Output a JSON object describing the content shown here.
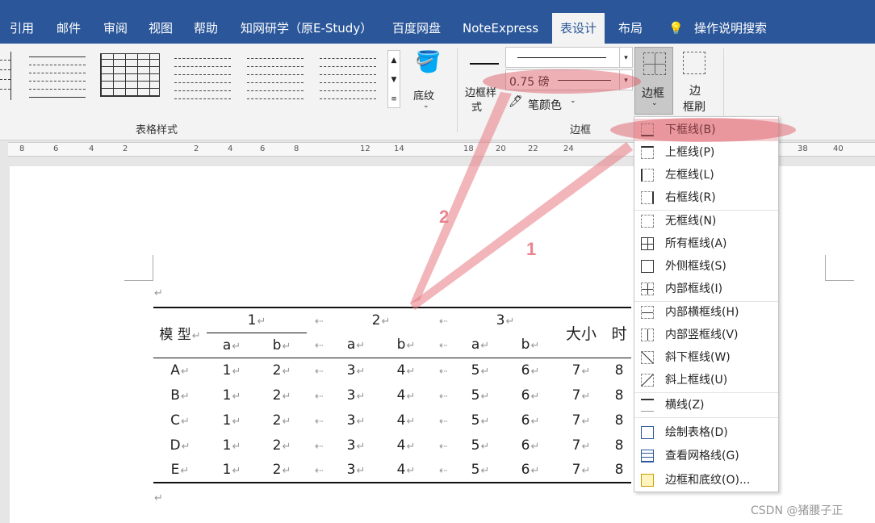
{
  "tabs": [
    "引用",
    "邮件",
    "审阅",
    "视图",
    "帮助",
    "知网研学（原E-Study）",
    "百度网盘",
    "NoteExpress",
    "表设计",
    "布局",
    "操作说明搜索"
  ],
  "active_tab": "表设计",
  "ribbon": {
    "table_styles_label": "表格样式",
    "shading_label": "底纹",
    "border_style_label": "边框样式",
    "border_style_line1": "边框样",
    "border_style_line2": "式",
    "pen_weight": "0.75 磅",
    "pen_color_label": "笔颜色",
    "borders_label": "边框",
    "borders_button": "边框",
    "border_painter_line1": "边",
    "border_painter_line2": "框刷",
    "borders_group_label": "边框"
  },
  "ruler": [
    "8",
    "6",
    "4",
    "2",
    "2",
    "4",
    "6",
    "8",
    "12",
    "14",
    "18",
    "20",
    "22",
    "24",
    "38",
    "40"
  ],
  "table": {
    "header1": [
      "模 型",
      "1",
      "",
      "2",
      "",
      "3",
      "大小",
      "时"
    ],
    "header2": [
      "a",
      "b",
      "",
      "a",
      "b",
      "",
      "a",
      "b"
    ],
    "rows": [
      [
        "A",
        "1",
        "2",
        "",
        "3",
        "4",
        "",
        "5",
        "6",
        "7",
        "8"
      ],
      [
        "B",
        "1",
        "2",
        "",
        "3",
        "4",
        "",
        "5",
        "6",
        "7",
        "8"
      ],
      [
        "C",
        "1",
        "2",
        "",
        "3",
        "4",
        "",
        "5",
        "6",
        "7",
        "8"
      ],
      [
        "D",
        "1",
        "2",
        "",
        "3",
        "4",
        "",
        "5",
        "6",
        "7",
        "8"
      ],
      [
        "E",
        "1",
        "2",
        "",
        "3",
        "4",
        "",
        "5",
        "6",
        "7",
        "8"
      ]
    ]
  },
  "menu": [
    {
      "label": "下框线(B)"
    },
    {
      "label": "上框线(P)"
    },
    {
      "label": "左框线(L)"
    },
    {
      "label": "右框线(R)"
    },
    {
      "label": "无框线(N)"
    },
    {
      "label": "所有框线(A)"
    },
    {
      "label": "外侧框线(S)"
    },
    {
      "label": "内部框线(I)"
    },
    {
      "label": "内部横框线(H)"
    },
    {
      "label": "内部竖框线(V)"
    },
    {
      "label": "斜下框线(W)"
    },
    {
      "label": "斜上框线(U)"
    },
    {
      "label": "横线(Z)"
    },
    {
      "label": "绘制表格(D)"
    },
    {
      "label": "查看网格线(G)"
    },
    {
      "label": "边框和底纹(O)..."
    }
  ],
  "annotations": {
    "arrow1": "1",
    "arrow2": "2"
  },
  "watermark": "CSDN @猪腰子正",
  "colors": {
    "ribbon_blue": "#2b579a",
    "highlight": "#dc505a"
  }
}
